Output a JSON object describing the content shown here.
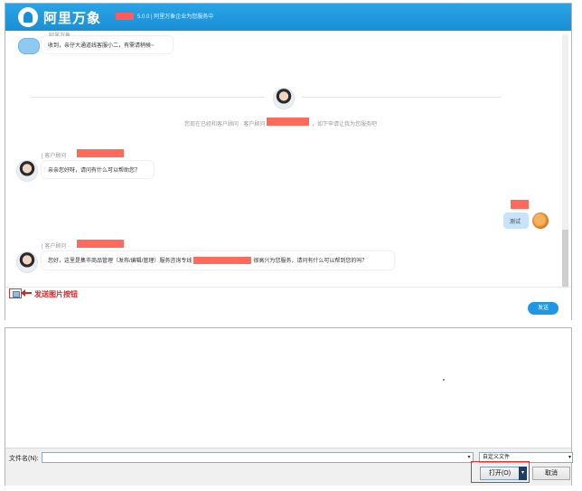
{
  "app": {
    "brand": "阿里万象",
    "header_note": "5.0.0 | 阿里万象企业为您服务中"
  },
  "messages": {
    "bot_meta": "阿里万象",
    "bot_text": "收到，亲仔大通道线客服小二，有需请稍候~",
    "system_text": "您现在已经和客户顾问 · 客户顾问",
    "system_tail": "，如下申请让我为您服务吧",
    "agent_meta_1": "[ 客户顾问 ·",
    "agent_text_1": "亲亲您好呀，请问有什么可以帮助您？",
    "user_text": "测试",
    "agent_meta_2": "[ 客户顾问 ·",
    "agent_text_2a": "您好，这里是集市商品管理（发布/编辑/管理）服务咨询专线",
    "agent_text_2b": "很高兴为您服务，请问有什么可以帮到您的吗？"
  },
  "input": {
    "send_label": "发送",
    "annotation": "发送图片按钮"
  },
  "dialog": {
    "filename_label": "文件名(N):",
    "filename_value": "",
    "filetype_value": "自定义文件",
    "open_label": "打开(O)",
    "cancel_label": "取消"
  },
  "colors": {
    "header": "#1a8fd6",
    "redact": "#ff6a5a",
    "annotation": "#dd2222"
  },
  "icons": {
    "image_button": "image-icon",
    "split_dropdown": "chevron-down-icon"
  }
}
